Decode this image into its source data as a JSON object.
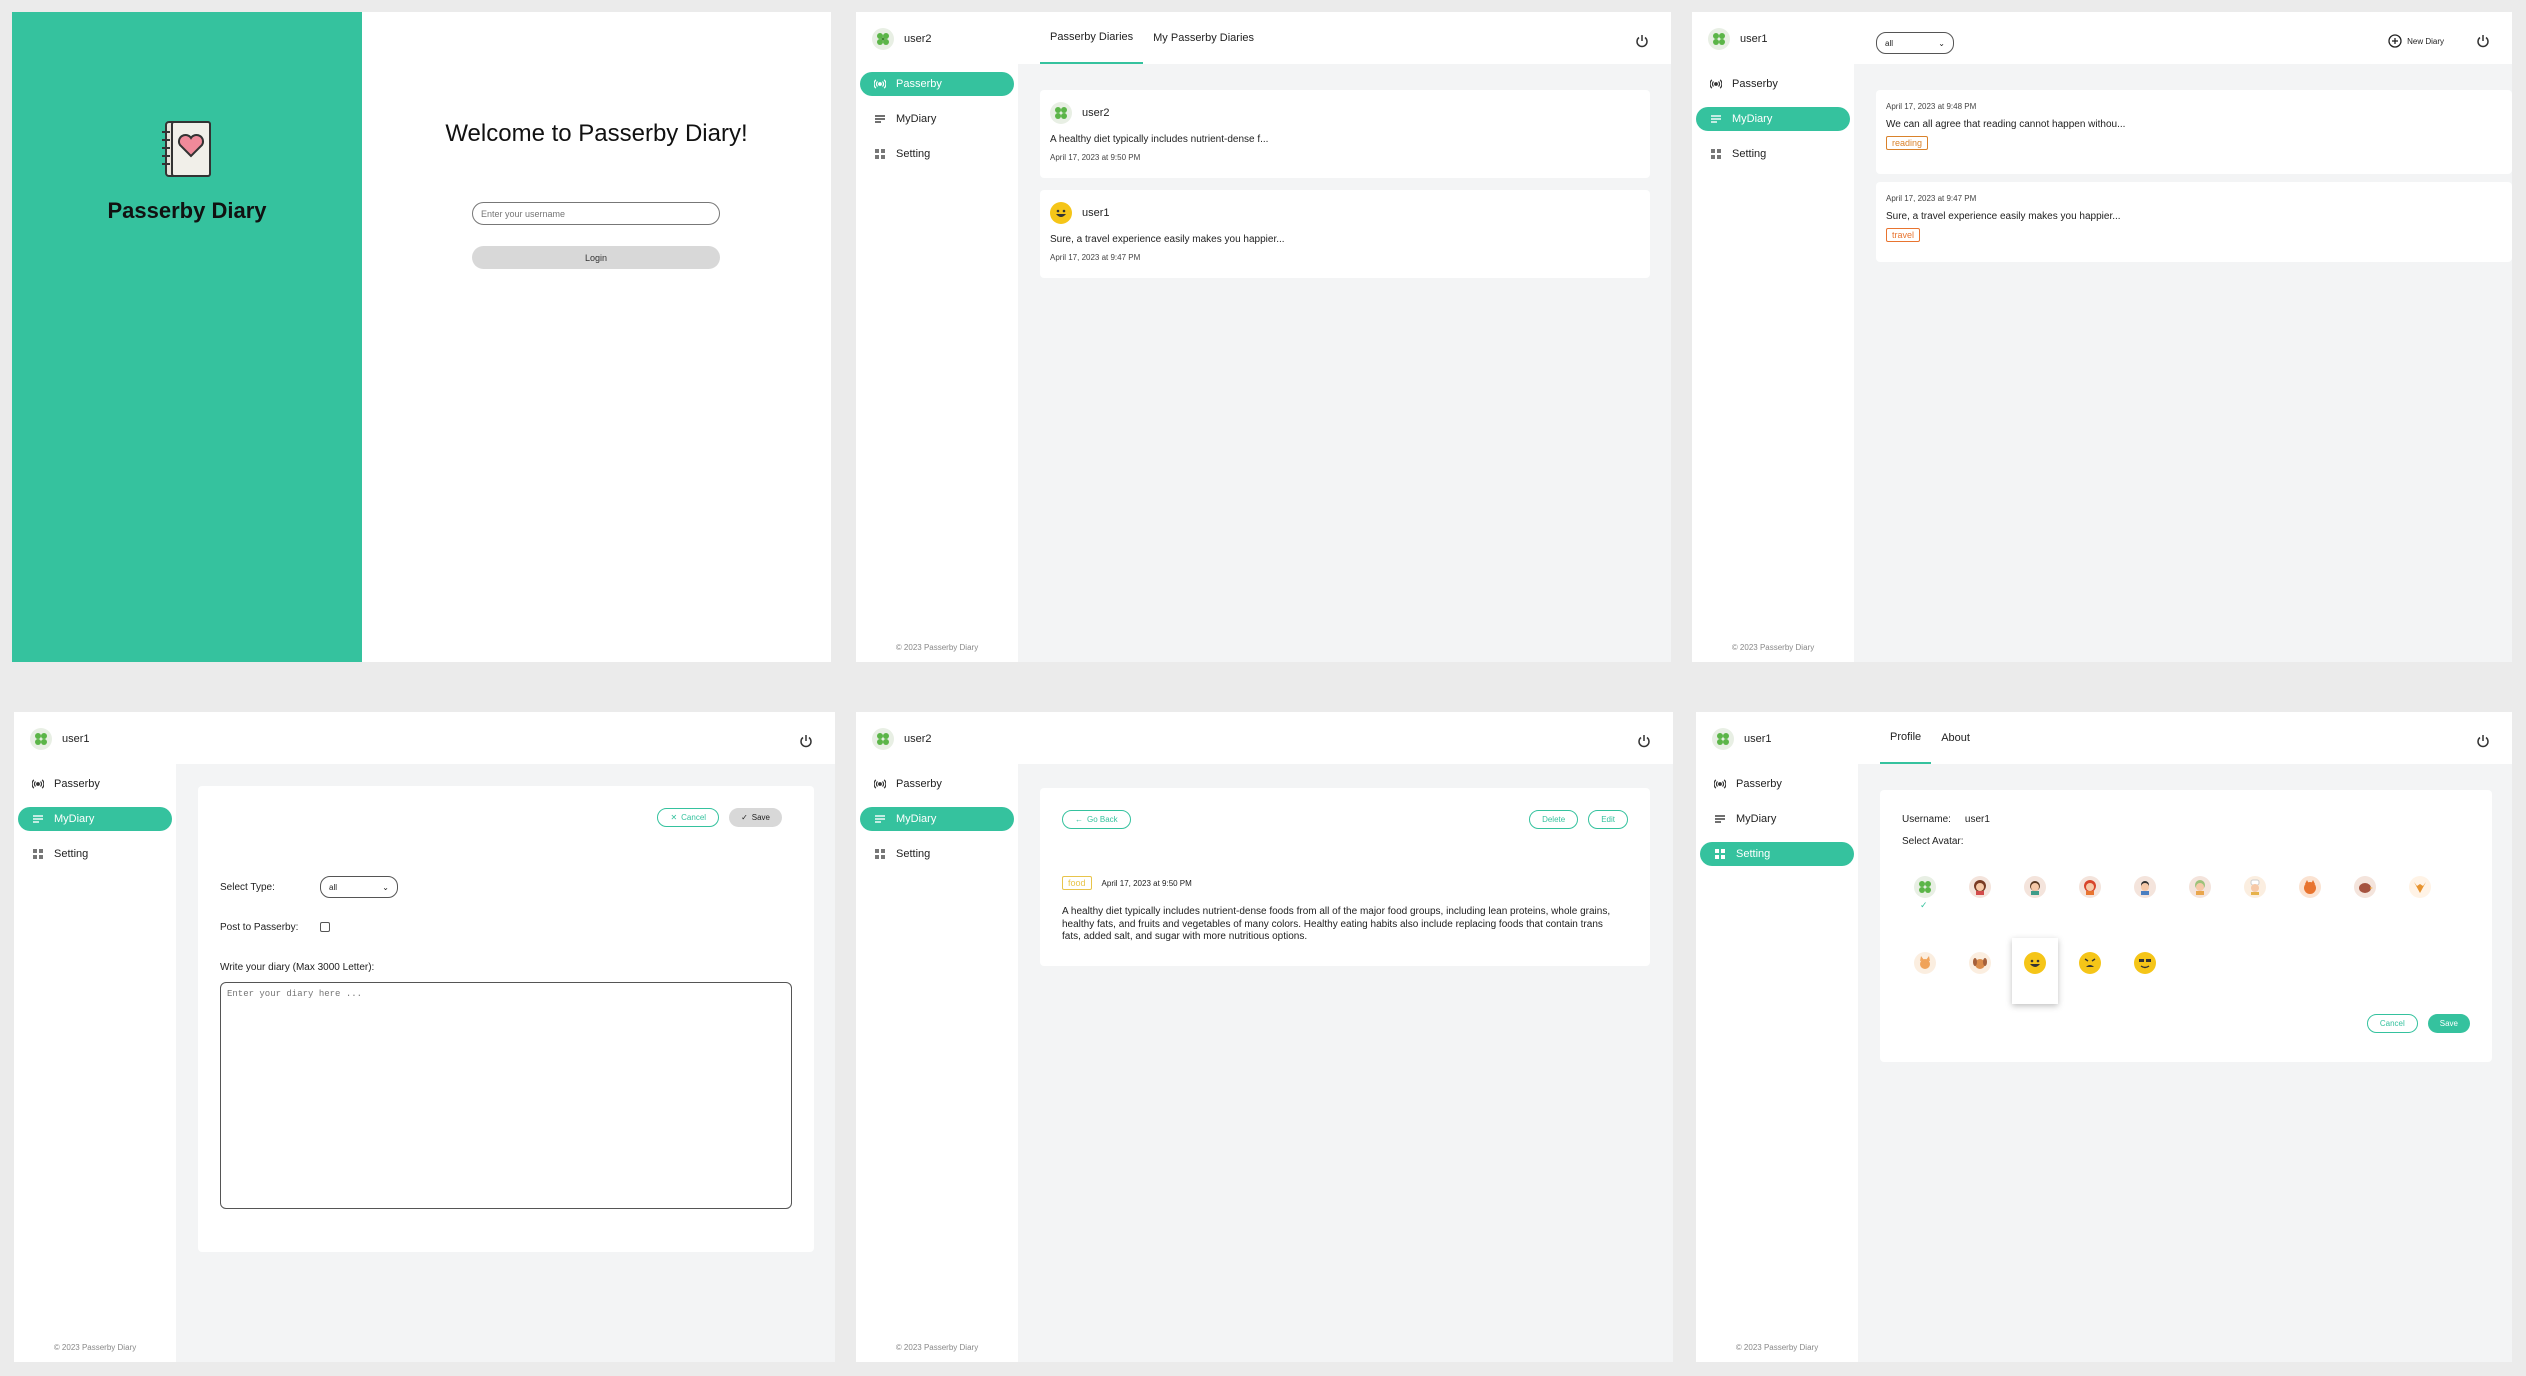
{
  "login": {
    "brand": "Passerby Diary",
    "welcome": "Welcome to Passerby Diary!",
    "username_placeholder": "Enter your username",
    "login_label": "Login"
  },
  "common": {
    "nav_passerby": "Passerby",
    "nav_mydiary": "MyDiary",
    "nav_setting": "Setting",
    "copyright": "© 2023 Passerby Diary",
    "accent": "#35c29e"
  },
  "passerby_screen": {
    "user": "user2",
    "tabs": [
      "Passerby Diaries",
      "My Passerby Diaries"
    ],
    "feed": [
      {
        "user": "user2",
        "text": "A healthy diet typically includes nutrient-dense f...",
        "date": "April 17, 2023 at 9:50 PM"
      },
      {
        "user": "user1",
        "text": "Sure, a travel experience easily makes you happier...",
        "date": "April 17, 2023 at 9:47 PM"
      }
    ]
  },
  "mydiary_screen": {
    "user": "user1",
    "filter_value": "all",
    "new_diary": "New Diary",
    "entries": [
      {
        "date": "April 17, 2023 at 9:48 PM",
        "text": "We can all agree that reading cannot happen withou...",
        "tag": "reading",
        "tag_color": "#d9822b"
      },
      {
        "date": "April 17, 2023 at 9:47 PM",
        "text": "Sure, a travel experience easily makes you happier...",
        "tag": "travel",
        "tag_color": "#e8742f"
      }
    ]
  },
  "new_diary_screen": {
    "user": "user1",
    "cancel": "Cancel",
    "save": "Save",
    "select_type_label": "Select Type:",
    "select_type_value": "all",
    "post_label": "Post to Passerby:",
    "write_label": "Write your diary (Max 3000 Letter):",
    "textarea_placeholder": "Enter your diary here ..."
  },
  "detail_screen": {
    "user": "user2",
    "go_back": "Go Back",
    "delete": "Delete",
    "edit": "Edit",
    "tag": "food",
    "tag_color": "#e8c44a",
    "date": "April 17, 2023 at 9:50 PM",
    "text": "A healthy diet typically includes nutrient-dense foods from all of the major food groups, including lean proteins, whole grains, healthy fats, and fruits and vegetables of many colors. Healthy eating habits also include replacing foods that contain trans fats, added salt, and sugar with more nutritious options."
  },
  "setting_screen": {
    "user": "user1",
    "tabs": [
      "Profile",
      "About"
    ],
    "username_label": "Username:",
    "username_value": "user1",
    "select_avatar_label": "Select Avatar:",
    "cancel": "Cancel",
    "save": "Save",
    "selected_avatar": "clover-icon",
    "avatars": [
      "clover-icon",
      "girl-icon",
      "boy-icon",
      "redhead-icon",
      "man-icon",
      "grandma-icon",
      "chef-icon",
      "orange-cat-icon",
      "bird-icon",
      "fox-icon",
      "cat-icon",
      "dog-icon",
      "grin-emoji-icon",
      "angry-emoji-icon",
      "cool-emoji-icon"
    ]
  }
}
